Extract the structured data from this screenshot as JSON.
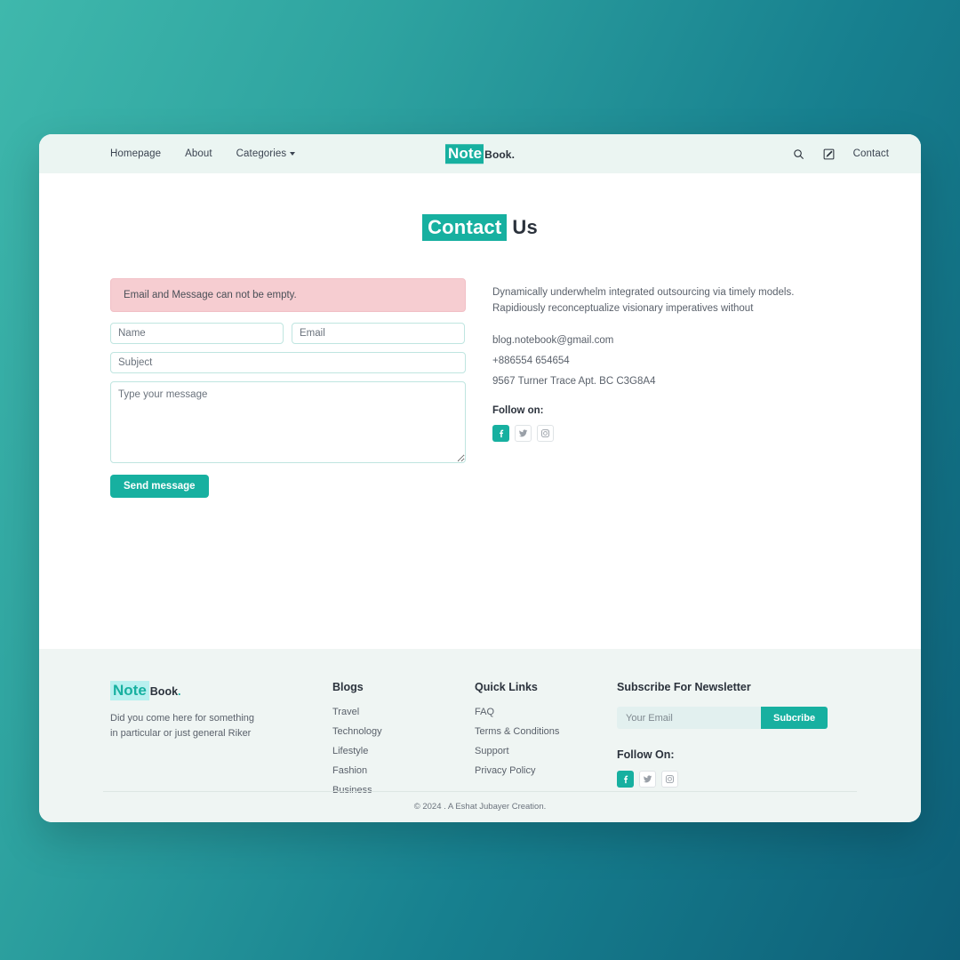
{
  "navbar": {
    "links": [
      {
        "label": "Homepage",
        "has_caret": false
      },
      {
        "label": "About",
        "has_caret": false
      },
      {
        "label": "Categories",
        "has_caret": true
      }
    ],
    "logo": {
      "highlight": "Note",
      "rest": "Book",
      "dot": "."
    },
    "icons": [
      "search-icon",
      "edit-icon"
    ],
    "contact_label": "Contact"
  },
  "main": {
    "title": {
      "highlight": "Contact",
      "rest": "Us"
    },
    "alert": "Email and Message can not be empty.",
    "form": {
      "name_placeholder": "Name",
      "name_value": "",
      "email_placeholder": "Email",
      "email_value": "",
      "subject_placeholder": "Subject",
      "subject_value": "",
      "message_placeholder": "Type your message",
      "message_value": "",
      "submit_label": "Send message"
    },
    "info": {
      "description": "Dynamically underwhelm integrated outsourcing via timely models. Rapidiously reconceptualize visionary imperatives without",
      "email": "blog.notebook@gmail.com",
      "phone": "+886554 654654",
      "address": "9567 Turner Trace Apt. BC C3G8A4",
      "follow_label": "Follow on:",
      "socials": [
        "facebook-icon",
        "twitter-icon",
        "instagram-icon"
      ]
    }
  },
  "footer": {
    "logo": {
      "highlight": "Note",
      "rest": "Book",
      "dot": "."
    },
    "brand_description": "Did you come here for something in particular or just general Riker",
    "blogs": {
      "title": "Blogs",
      "links": [
        "Travel",
        "Technology",
        "Lifestyle",
        "Fashion",
        "Business"
      ]
    },
    "quick_links": {
      "title": "Quick Links",
      "links": [
        "FAQ",
        "Terms & Conditions",
        "Support",
        "Privacy Policy"
      ]
    },
    "newsletter": {
      "title": "Subscribe For Newsletter",
      "input_placeholder": "Your Email",
      "input_value": "",
      "button_label": "Subcribe",
      "follow_label": "Follow On:",
      "socials": [
        "facebook-icon",
        "twitter-icon",
        "instagram-icon"
      ]
    },
    "copyright": "© 2024 . A Eshat Jubayer Creation."
  },
  "colors": {
    "accent": "#17b0a0",
    "nav_bg": "#ebf5f2",
    "footer_bg": "#eff5f3",
    "alert_bg": "#f6cdd1",
    "page_bg_from": "#3fb8ac",
    "page_bg_to": "#0d5f78"
  }
}
